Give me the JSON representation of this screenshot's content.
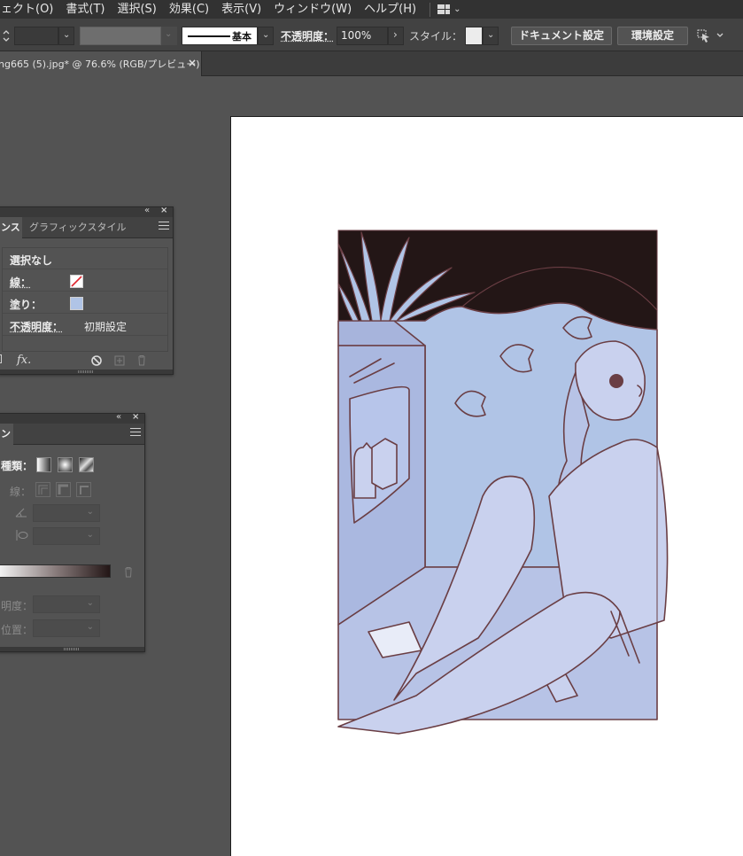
{
  "menubar": {
    "items": [
      "ェクト(O)",
      "書式(T)",
      "選択(S)",
      "効果(C)",
      "表示(V)",
      "ウィンドウ(W)",
      "ヘルプ(H)"
    ]
  },
  "controlbar": {
    "stroke_style_label": "基本",
    "opacity_label": "不透明度：",
    "opacity_value": "100%",
    "style_label": "スタイル：",
    "document_setup_button": "ドキュメント設定",
    "preferences_button": "環境設定"
  },
  "document_tab": {
    "title": "ng665 (5).jpg* @ 76.6% (RGB/プレビュー)",
    "close": "×"
  },
  "appearance_panel": {
    "tab_active": "ンス",
    "tab_inactive": "グラフィックスタイル",
    "selection": "選択なし",
    "stroke_label": "線：",
    "fill_label": "塗り：",
    "opacity_label": "不透明度：",
    "opacity_value": "初期設定",
    "fx_label": "fx."
  },
  "gradient_panel": {
    "tab_active": "ン",
    "type_label": "種類：",
    "stroke_label": "線：",
    "opacity_label": "明度：",
    "location_label": "位置："
  },
  "colors": {
    "app_bg": "#535353",
    "illustration_dark": "#231616",
    "illustration_wall": "#b0c4e6",
    "illustration_figure": "#c9d1ee",
    "illustration_line": "#6a3e44"
  }
}
